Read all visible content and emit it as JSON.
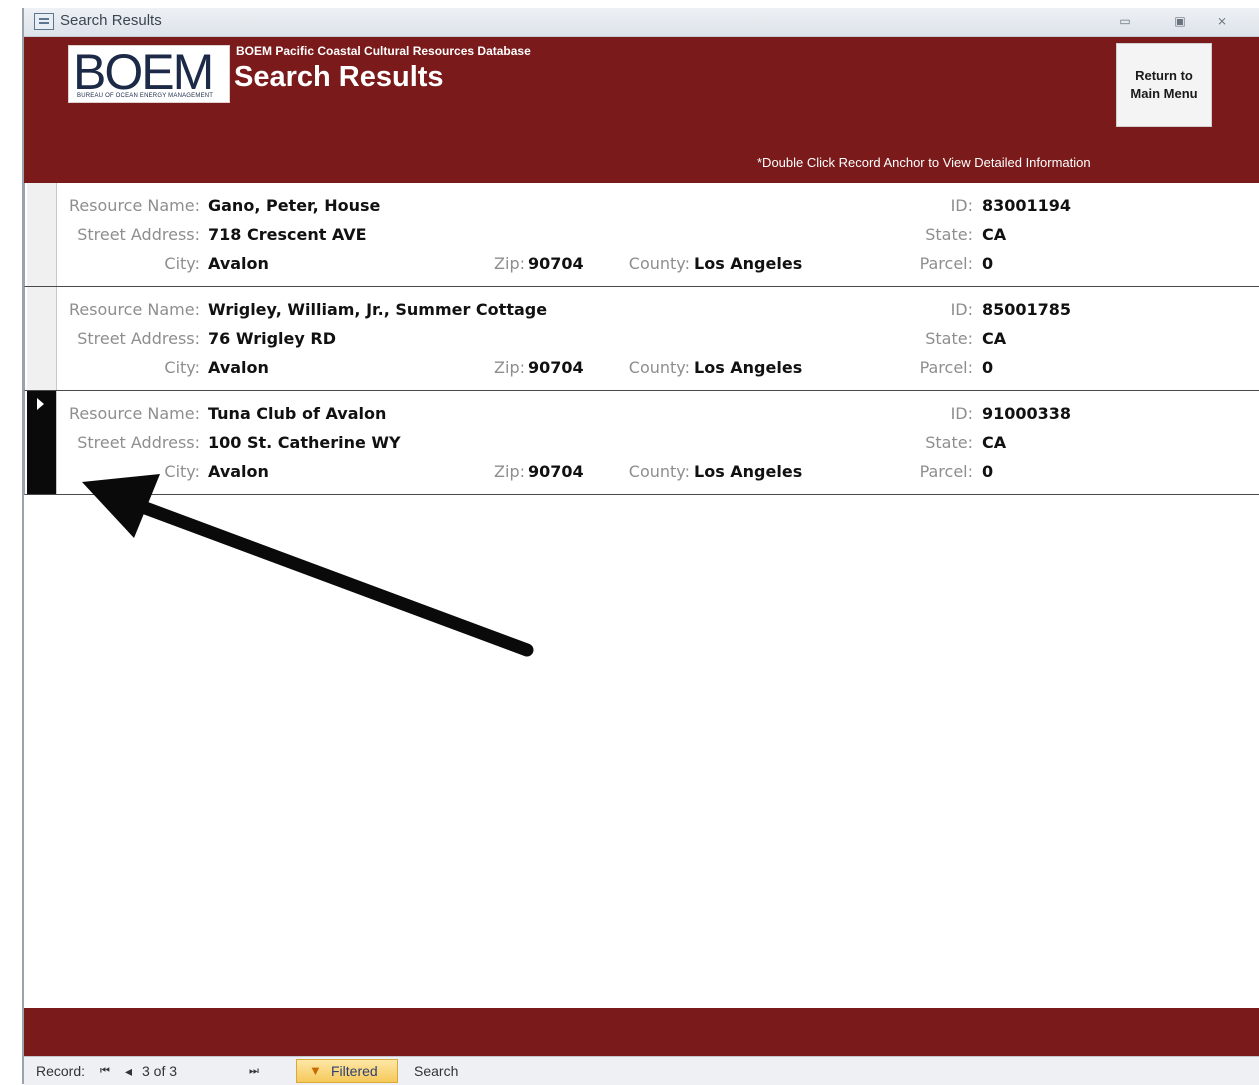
{
  "window": {
    "title": "Search Results",
    "controls": [
      "minimize-icon",
      "restore-icon",
      "close-icon"
    ],
    "minimize_glyph": "▭",
    "restore_glyph": "▣",
    "close_glyph": "⨯"
  },
  "header": {
    "logo_text": "BOEM",
    "logo_subtext": "BUREAU OF OCEAN ENERGY MANAGEMENT",
    "db_title": "BOEM Pacific Coastal Cultural Resources Database",
    "form_title": "Search Results",
    "return_button": "Return to Main Menu",
    "hint": "*Double Click Record Anchor to View Detailed Information",
    "color": "#7a1a1a"
  },
  "labels": {
    "resource_name": "Resource Name:",
    "street_address": "Street Address:",
    "city": "City:",
    "zip": "Zip:",
    "county": "County:",
    "id": "ID:",
    "state": "State:",
    "parcel": "Parcel:"
  },
  "records": [
    {
      "resource_name": "Gano, Peter, House",
      "street_address": "718 Crescent AVE",
      "city": "Avalon",
      "zip": "90704",
      "county": "Los Angeles",
      "id": "83001194",
      "state": "CA",
      "parcel": "0",
      "selected": false
    },
    {
      "resource_name": "Wrigley, William, Jr., Summer Cottage",
      "street_address": "76 Wrigley RD",
      "city": "Avalon",
      "zip": "90704",
      "county": "Los Angeles",
      "id": "85001785",
      "state": "CA",
      "parcel": "0",
      "selected": false
    },
    {
      "resource_name": "Tuna Club of Avalon",
      "street_address": "100 St. Catherine WY",
      "city": "Avalon",
      "zip": "90704",
      "county": "Los Angeles",
      "id": "91000338",
      "state": "CA",
      "parcel": "0",
      "selected": true
    }
  ],
  "status_bar": {
    "record_label": "Record:",
    "first_glyph": "⏮",
    "prev_glyph": "◂",
    "position": "3 of 3",
    "last_glyph": "⏭",
    "filtered": "Filtered",
    "search": "Search"
  }
}
